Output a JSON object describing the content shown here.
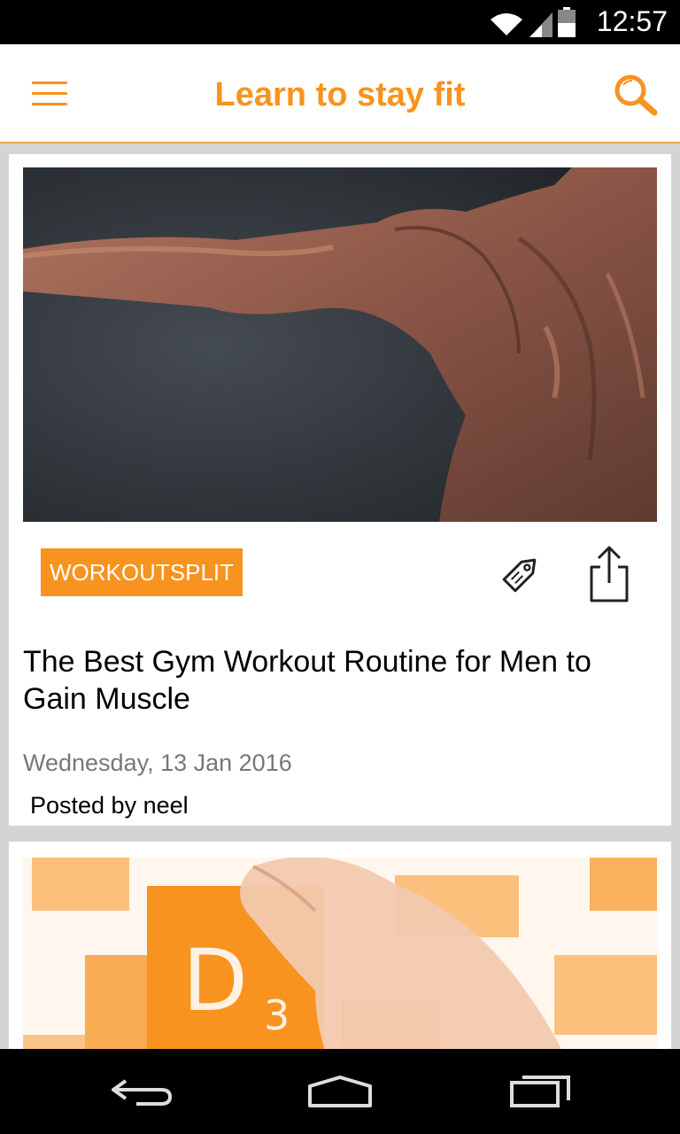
{
  "status_bar": {
    "time": "12:57",
    "icons": [
      "wifi-icon",
      "signal-icon",
      "battery-icon"
    ]
  },
  "app_bar": {
    "title": "Learn to stay fit",
    "menu_icon": "menu-icon",
    "search_icon": "search-icon"
  },
  "articles": [
    {
      "category": "WORKOUTSPLIT",
      "title": "The Best Gym Workout Routine for Men to Gain Muscle",
      "date": "Wednesday, 13 Jan 2016",
      "author": "Posted by neel",
      "tag_icon": "tag-icon",
      "share_icon": "share-icon"
    },
    {
      "image_text": "D",
      "image_subscript": "3"
    }
  ],
  "nav_bar": {
    "buttons": [
      "back-icon",
      "home-icon",
      "recents-icon"
    ]
  },
  "colors": {
    "accent": "#f7931e",
    "status_bar": "#000000",
    "background": "#d4d4d4",
    "date_text": "#777777"
  }
}
